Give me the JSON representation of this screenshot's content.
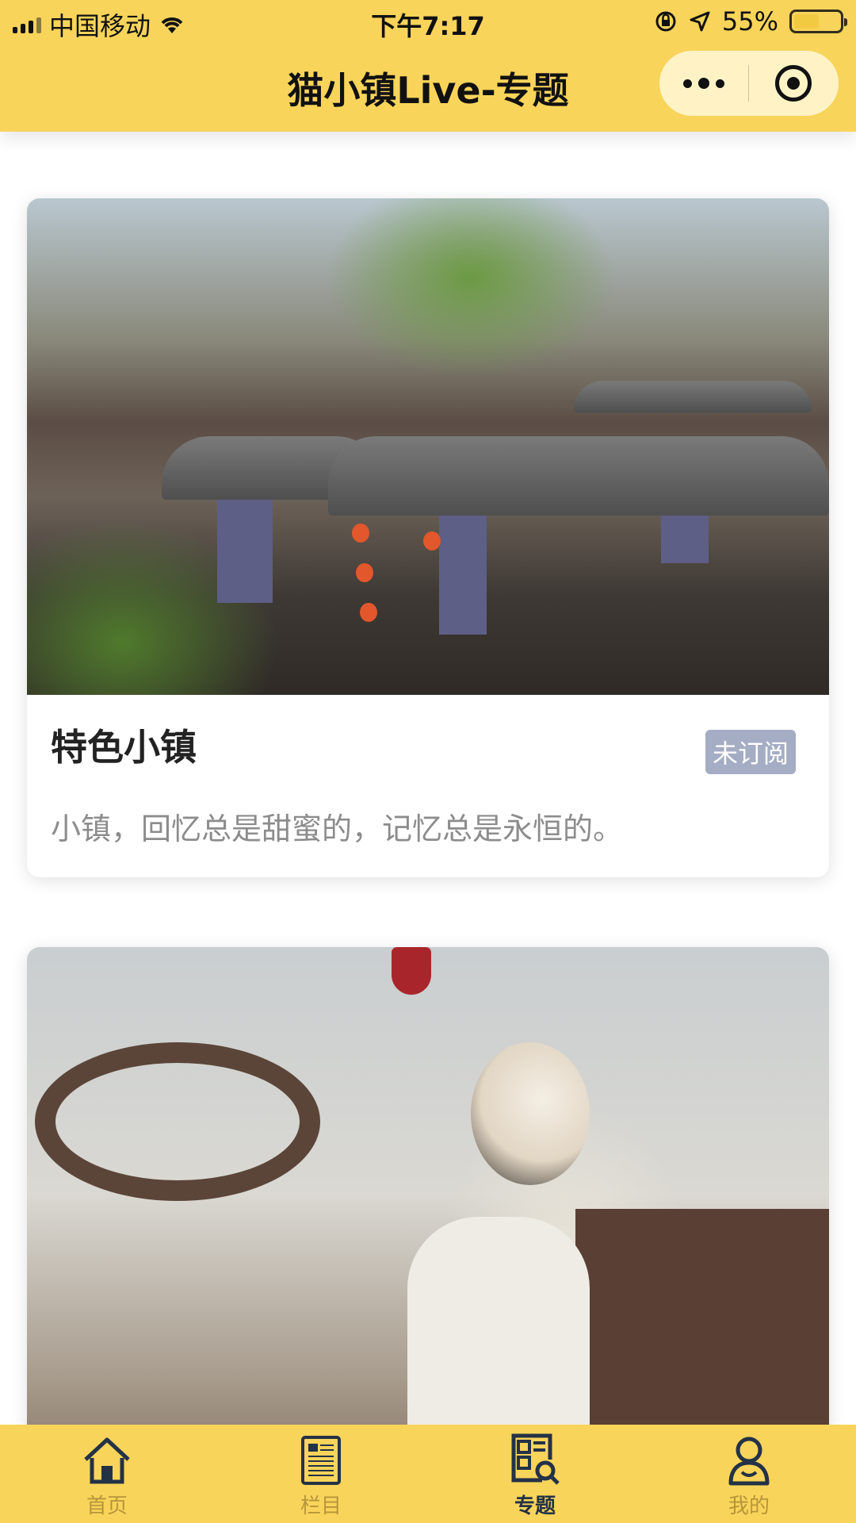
{
  "status_bar": {
    "carrier": "中国移动",
    "time": "下午7:17",
    "battery_percent": "55%",
    "battery_level": 0.55,
    "icons": [
      "signal-icon",
      "wifi-icon",
      "orientation-lock-icon",
      "location-arrow-icon",
      "battery-icon"
    ]
  },
  "header": {
    "title": "猫小镇Live-专题",
    "capsule": {
      "more_icon": "more-dots-icon",
      "close_icon": "target-icon"
    }
  },
  "cards": [
    {
      "title": "特色小镇",
      "badge": "未订阅",
      "description": "小镇，回忆总是甜蜜的，记忆总是永恒的。",
      "image": "water-town-boats-photo"
    },
    {
      "title": "",
      "badge": "",
      "description": "",
      "image": "woman-on-boat-photo"
    }
  ],
  "tabbar": {
    "items": [
      {
        "label": "首页",
        "icon": "home-icon",
        "active": false
      },
      {
        "label": "栏目",
        "icon": "column-icon",
        "active": false
      },
      {
        "label": "专题",
        "icon": "topic-search-icon",
        "active": true
      },
      {
        "label": "我的",
        "icon": "user-icon",
        "active": false
      }
    ]
  },
  "colors": {
    "brand_yellow": "#f8d45a",
    "capsule_bg": "#fff3c6",
    "badge_bg": "#a4adc4",
    "inactive_tab": "#b7953a",
    "active_tab": "#243246"
  }
}
